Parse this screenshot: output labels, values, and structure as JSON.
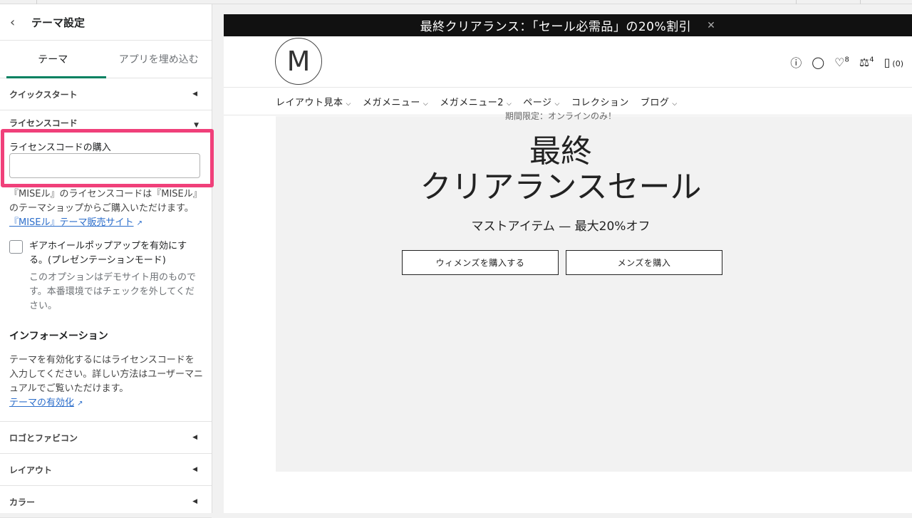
{
  "sidebar": {
    "title": "テーマ設定",
    "tabs": [
      {
        "label": "テーマ",
        "active": true
      },
      {
        "label": "アプリを埋め込む",
        "active": false
      }
    ],
    "quickstart": "クイックスタート",
    "license_section": "ライセンスコード",
    "license_field_label": "ライセンスコードの購入",
    "license_field_value": "",
    "license_help": "『MISEル』のライセンスコードは『MISEル』のテーマショップからご購入いただけます。",
    "license_link": "『MISEル』テーマ販売サイト",
    "gear_checkbox_label": "ギアホイールポップアップを有効にする。(プレゼンテーションモード)",
    "gear_checkbox_help": "このオプションはデモサイト用のものです。本番環境ではチェックを外してください。",
    "info_title": "インフォーメーション",
    "info_text": "テーマを有効化するにはライセンスコードを入力してください。詳しい方法はユーザーマニュアルでご覧いただけます。",
    "info_link": "テーマの有効化",
    "sections": [
      "ロゴとファビコン",
      "レイアウト",
      "カラー"
    ]
  },
  "preview": {
    "announcement": "最終クリアランス：「セール必需品」の20%割引",
    "logo_letter": "M",
    "wishlist_count": "8",
    "compare_count": "4",
    "cart_count": "(0)",
    "nav": [
      "レイアウト見本",
      "メガメニュー",
      "メガメニュー2",
      "ページ",
      "コレクション",
      "ブログ"
    ],
    "nav_has_dropdown": [
      true,
      true,
      true,
      true,
      false,
      true
    ],
    "hero": {
      "eyebrow": "期間限定：オンラインのみ！",
      "title_line1": "最終",
      "title_line2": "クリアランスセール",
      "subtitle": "マストアイテム — 最大20%オフ",
      "button_women": "ウィメンズを購入する",
      "button_men": "メンズを購入"
    }
  },
  "colors": {
    "accent_tab": "#008060",
    "highlight_box": "#f0407a",
    "link": "#2c6ecb"
  }
}
